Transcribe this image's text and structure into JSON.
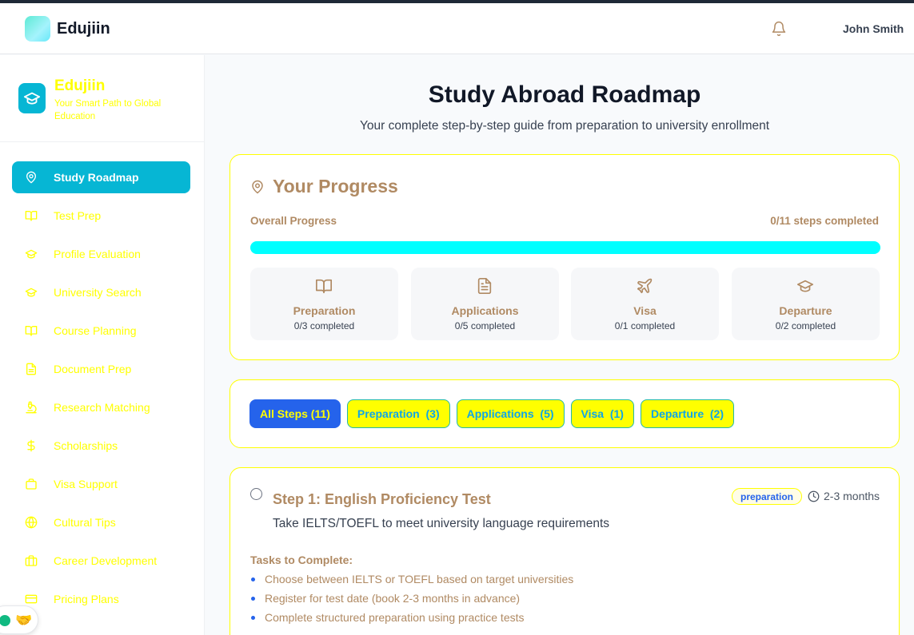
{
  "header": {
    "brand": "Edujiin",
    "user_name": "John Smith",
    "icons": [
      "logo-icon",
      "bell-icon"
    ]
  },
  "sidebar": {
    "brand_title": "Edujiin",
    "brand_tagline": "Your Smart Path to Global Education",
    "items": [
      {
        "label": "Study Roadmap",
        "icon": "map-pin-icon",
        "active": true
      },
      {
        "label": "Test Prep",
        "icon": "book-open-icon",
        "active": false
      },
      {
        "label": "Profile Evaluation",
        "icon": "graduation-cap-icon",
        "active": false
      },
      {
        "label": "University Search",
        "icon": "graduation-cap-icon",
        "active": false
      },
      {
        "label": "Course Planning",
        "icon": "book-open-icon",
        "active": false
      },
      {
        "label": "Document Prep",
        "icon": "file-text-icon",
        "active": false
      },
      {
        "label": "Research Matching",
        "icon": "microscope-icon",
        "active": false
      },
      {
        "label": "Scholarships",
        "icon": "dollar-icon",
        "active": false
      },
      {
        "label": "Visa Support",
        "icon": "passport-icon",
        "active": false
      },
      {
        "label": "Cultural Tips",
        "icon": "globe-icon",
        "active": false
      },
      {
        "label": "Career Development",
        "icon": "briefcase-icon",
        "active": false
      },
      {
        "label": "Pricing Plans",
        "icon": "credit-card-icon",
        "active": false
      }
    ],
    "accent_color": "#06b6d4",
    "label_color": "#ffff00"
  },
  "main": {
    "title": "Study Abroad Roadmap",
    "subtitle": "Your complete step-by-step guide from preparation to university enrollment"
  },
  "progress": {
    "title": "Your Progress",
    "overall_label": "Overall Progress",
    "steps_text": "0/11 steps completed",
    "fraction": 0.0,
    "phases": [
      {
        "name": "Preparation",
        "count": "0/3 completed",
        "icon": "book-open-icon"
      },
      {
        "name": "Applications",
        "count": "0/5 completed",
        "icon": "file-text-icon"
      },
      {
        "name": "Visa",
        "count": "0/1 completed",
        "icon": "plane-icon"
      },
      {
        "name": "Departure",
        "count": "0/2 completed",
        "icon": "graduation-cap-icon"
      }
    ]
  },
  "filters": [
    {
      "label": "All Steps (11)",
      "active": true
    },
    {
      "label": "Preparation  (3)",
      "active": false
    },
    {
      "label": "Applications  (5)",
      "active": false
    },
    {
      "label": "Visa  (1)",
      "active": false
    },
    {
      "label": "Departure  (2)",
      "active": false
    }
  ],
  "step": {
    "title": "Step 1: English Proficiency Test",
    "badge": "preparation",
    "duration": "2-3 months",
    "description": "Take IELTS/TOEFL to meet university language requirements",
    "tasks_label": "Tasks to Complete:",
    "tasks": [
      "Choose between IELTS or TOEFL based on target universities",
      "Register for test date (book 2-3 months in advance)",
      "Complete structured preparation using practice tests"
    ],
    "completed": false
  }
}
